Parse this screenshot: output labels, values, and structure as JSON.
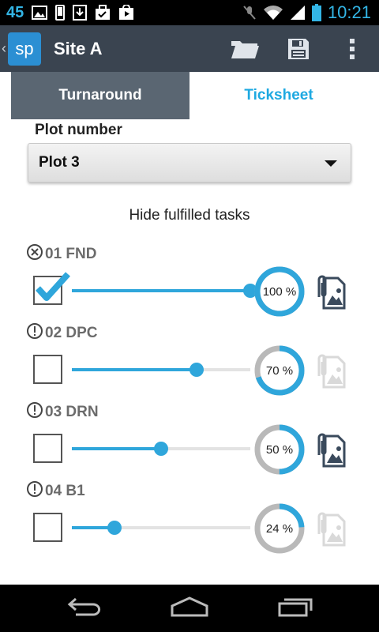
{
  "status_bar": {
    "notification_count": "45",
    "time": "10:21",
    "icons": [
      "image-icon",
      "phone-icon",
      "download-icon",
      "briefcase-check-icon",
      "play-store-icon",
      "mute-icon",
      "wifi-icon",
      "signal-icon",
      "battery-icon"
    ]
  },
  "action_bar": {
    "app_icon_text": "sp",
    "title": "Site A",
    "actions": [
      "folder-icon",
      "save-icon",
      "overflow-menu-icon"
    ]
  },
  "tabs": [
    {
      "label": "Turnaround",
      "selected": false
    },
    {
      "label": "Ticksheet",
      "selected": true
    }
  ],
  "plot": {
    "label": "Plot number",
    "selected": "Plot 3"
  },
  "hide_fulfilled_label": "Hide fulfilled tasks",
  "tasks": [
    {
      "name": "01 FND",
      "status_icon": "cancel-circle-icon",
      "checked": true,
      "progress": 100,
      "percent_label": "100 %",
      "attachment_enabled": true
    },
    {
      "name": "02 DPC",
      "status_icon": "alert-circle-icon",
      "checked": false,
      "progress": 70,
      "percent_label": "70 %",
      "attachment_enabled": false
    },
    {
      "name": "03 DRN",
      "status_icon": "alert-circle-icon",
      "checked": false,
      "progress": 50,
      "percent_label": "50 %",
      "attachment_enabled": true
    },
    {
      "name": "04 B1",
      "status_icon": "alert-circle-icon",
      "checked": false,
      "progress": 24,
      "percent_label": "24 %",
      "attachment_enabled": false
    }
  ],
  "colors": {
    "accent": "#2fa6db",
    "action_bar": "#3a4450",
    "tab_inactive": "#5a6672",
    "ring_track": "#b9b9b9",
    "attach_enabled": "#3a4a5c",
    "attach_disabled": "#d9d9d9"
  },
  "nav_bar": [
    "back-icon",
    "home-icon",
    "recent-apps-icon"
  ]
}
